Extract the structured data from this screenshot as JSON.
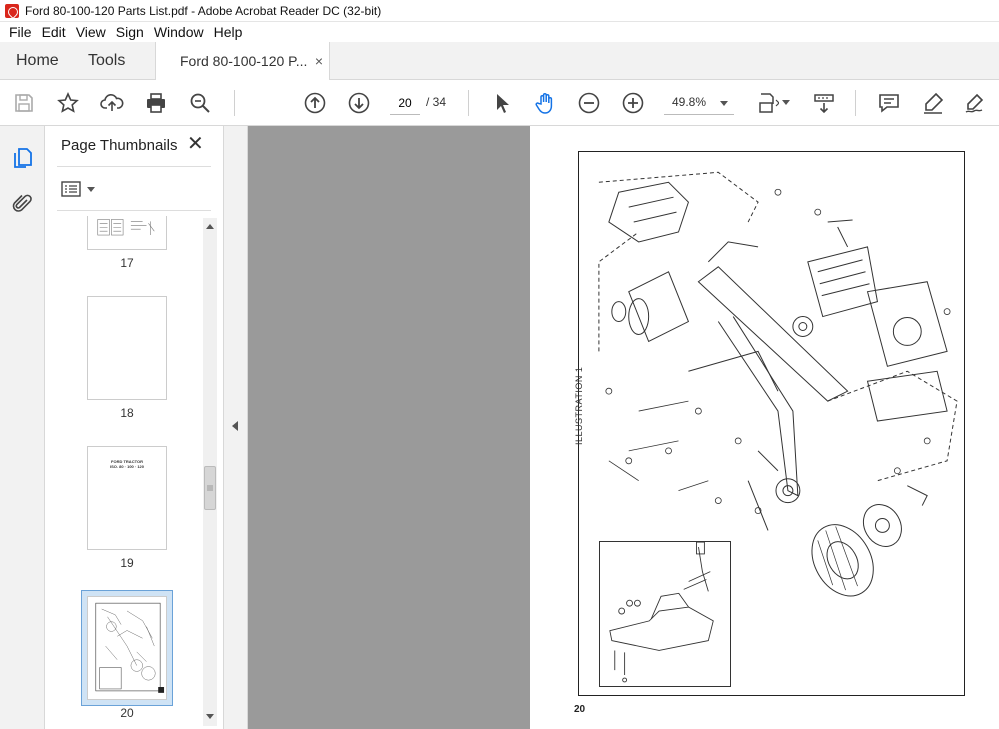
{
  "window": {
    "title": "Ford 80-100-120 Parts List.pdf - Adobe Acrobat Reader DC (32-bit)"
  },
  "menu": [
    "File",
    "Edit",
    "View",
    "Sign",
    "Window",
    "Help"
  ],
  "tabs": {
    "home": "Home",
    "tools": "Tools",
    "document": "Ford 80-100-120 P...",
    "close": "×"
  },
  "toolbar": {
    "icons": [
      "save-icon",
      "star-icon",
      "upload-icon",
      "print-icon",
      "zoom-search-icon",
      "page-up-icon",
      "page-down-icon",
      "select-arrow-icon",
      "hand-icon",
      "zoom-out-icon",
      "zoom-in-icon",
      "fit-page-icon",
      "scroll-mode-icon",
      "comment-icon",
      "highlight-icon",
      "sign-icon"
    ],
    "current_page": "20",
    "total_pages": "/ 34",
    "zoom": "49.8%"
  },
  "panel": {
    "title": "Page Thumbnails",
    "close": "✕",
    "thumbnails": [
      {
        "label": "17"
      },
      {
        "label": "18"
      },
      {
        "label": "19"
      },
      {
        "label": "20",
        "selected": true
      }
    ],
    "thumb19_lines": [
      "FORD TRACTOR",
      "ISO. 80 · 100 · 120"
    ]
  },
  "document": {
    "illustration_label": "ILLUSTRATION 1",
    "page_number": "20"
  },
  "colors": {
    "accent": "#1473e6",
    "doc_background": "#9a9a9a",
    "selected_thumb": "#cfe3f5"
  }
}
